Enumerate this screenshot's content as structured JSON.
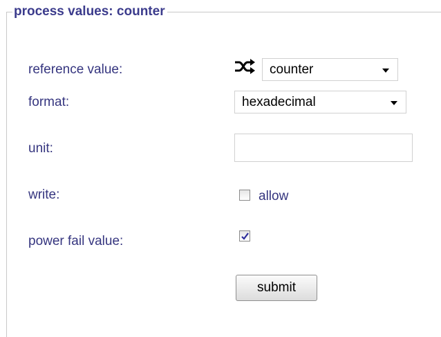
{
  "legend": "process values: counter",
  "fields": {
    "reference_value": {
      "label": "reference value:",
      "icon": "shuffle-icon",
      "selected": "counter"
    },
    "format": {
      "label": "format:",
      "selected": "hexadecimal"
    },
    "unit": {
      "label": "unit:",
      "value": ""
    },
    "write": {
      "label": "write:",
      "checkbox_label": "allow",
      "checked": false
    },
    "power_fail_value": {
      "label": "power fail value:",
      "checked": true
    }
  },
  "submit_label": "submit",
  "colors": {
    "label_text": "#35357f",
    "legend_text": "#3b3b8c",
    "border": "#c8c8c8"
  }
}
